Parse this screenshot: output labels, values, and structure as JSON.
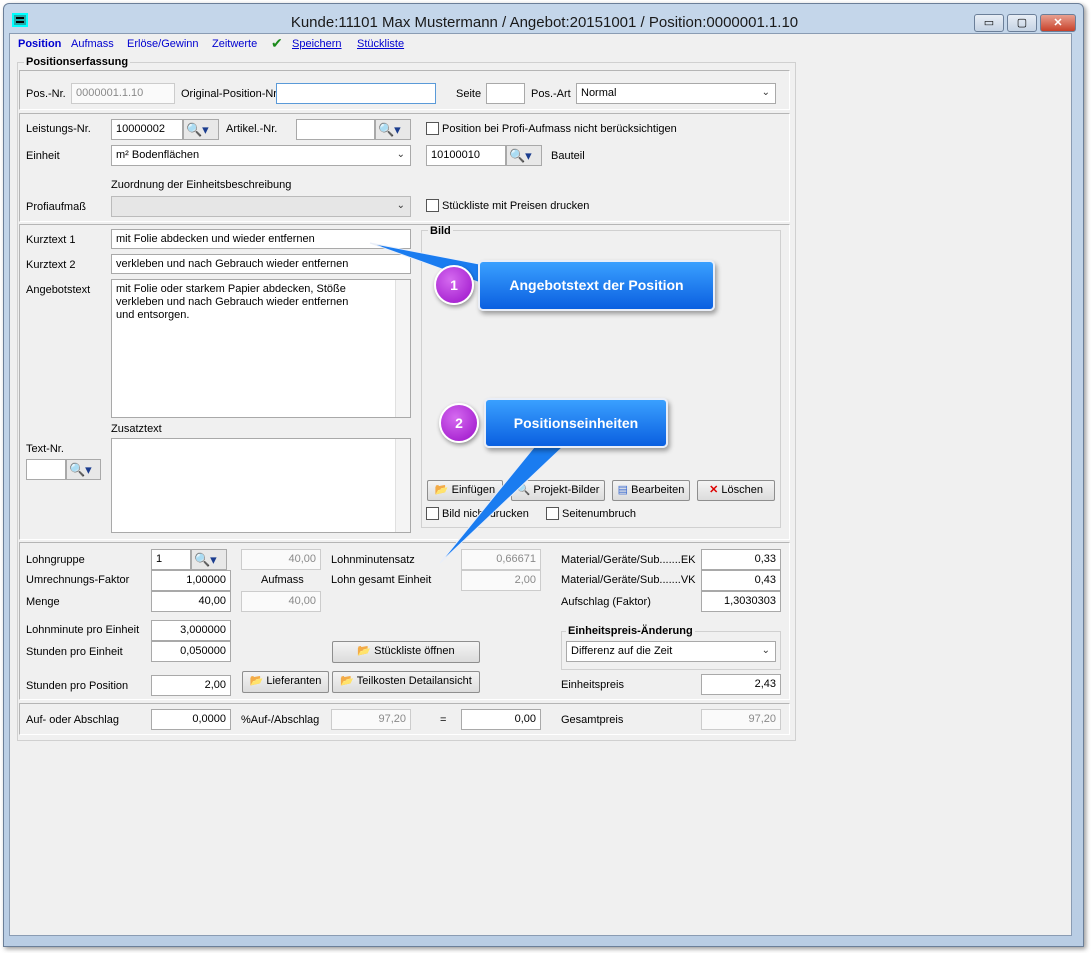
{
  "window": {
    "title": "Kunde:11101 Max Mustermann / Angebot:20151001  / Position:0000001.1.10",
    "controls": [
      "minimize",
      "maximize",
      "close"
    ]
  },
  "menu": {
    "position": "Position",
    "aufmass": "Aufmass",
    "erloese": "Erlöse/Gewinn",
    "zeitwerte": "Zeitwerte",
    "speichern": "Speichern",
    "stueckliste": "Stückliste"
  },
  "group_title": "Positionserfassung",
  "head": {
    "pos_nr_label": "Pos.-Nr.",
    "pos_nr": "0000001.1.10",
    "orig_label": "Original-Position-Nr.",
    "orig": "",
    "seite_label": "Seite",
    "seite": "",
    "posart_label": "Pos.-Art",
    "posart": "Normal"
  },
  "unit": {
    "leistung_label": "Leistungs-Nr.",
    "leistung": "10000002",
    "artikel_label": "Artikel.-Nr.",
    "artikel": "",
    "cb_profi": "Position bei Profi-Aufmass nicht berücksichtigen",
    "einheit_label": "Einheit",
    "einheit": "m² Bodenflächen",
    "bauteil_nr": "10100010",
    "bauteil_label": "Bauteil",
    "zuordnung_label": "Zuordnung der Einheitsbeschreibung",
    "profi_label": "Profiaufmaß",
    "profi": "",
    "cb_stueck": "Stückliste mit Preisen drucken"
  },
  "text": {
    "k1_label": "Kurztext 1",
    "k1": "mit Folie abdecken und wieder entfernen",
    "k2_label": "Kurztext 2",
    "k2": "verkleben und nach Gebrauch wieder entfernen",
    "angebot_label": "Angebotstext",
    "angebot": "mit Folie oder starkem Papier abdecken, Stöße\nverkleben und nach Gebrauch wieder entfernen\nund entsorgen.",
    "zusatz_label": "Zusatztext",
    "textnr_label": "Text-Nr.",
    "textnr": "",
    "zusatz": ""
  },
  "bild": {
    "title": "Bild",
    "einfuegen": "Einfügen",
    "projekt": "Projekt-Bilder",
    "bearbeiten": "Bearbeiten",
    "loeschen": "Löschen",
    "cb_nicht": "Bild nicht drucken",
    "cb_umbruch": "Seitenumbruch"
  },
  "callouts": [
    {
      "num": "1",
      "text": "Angebotstext der Position"
    },
    {
      "num": "2",
      "text": "Positionseinheiten"
    }
  ],
  "calc": {
    "lohngruppe_label": "Lohngruppe",
    "lohngruppe": "1",
    "aufmass_top": "40,00",
    "umrech_label": "Umrechnungs-Faktor",
    "umrech": "1,00000",
    "aufmass_label": "Aufmass",
    "menge_label": "Menge",
    "menge": "40,00",
    "aufmass_val": "40,00",
    "lmsatz_label": "Lohnminutensatz",
    "lmsatz": "0,66671",
    "lohn_label": "Lohn gesamt Einheit",
    "lohn": "2,00",
    "ek_label": "Material/Geräte/Sub.......EK",
    "ek": "0,33",
    "vk_label": "Material/Geräte/Sub.......VK",
    "vk": "0,43",
    "aufschlag_label": "Aufschlag (Faktor)",
    "aufschlag": "1,3030303",
    "lme_label": "Lohnminute pro Einheit",
    "lme": "3,000000",
    "spe_label": "Stunden pro Einheit",
    "spe": "0,050000",
    "spp_label": "Stunden pro Position",
    "spp": "2,00",
    "stueck_btn": "Stückliste öffnen",
    "lief_btn": "Lieferanten",
    "teil_btn": "Teilkosten Detailansicht",
    "ep_group": "Einheitspreis-Änderung",
    "ep_select": "Differenz auf die Zeit",
    "ep_label": "Einheitspreis",
    "ep": "2,43"
  },
  "total": {
    "auf_label": "Auf- oder Abschlag",
    "auf": "0,0000",
    "pct_label": "%Auf-/Abschlag",
    "pct": "97,20",
    "eq": "=",
    "eqval": "0,00",
    "gesamt_label": "Gesamtpreis",
    "gesamt": "97,20"
  },
  "colors": {
    "link": "#0000d0",
    "callout": "#1a7cf0",
    "badge": "#b020d8"
  }
}
